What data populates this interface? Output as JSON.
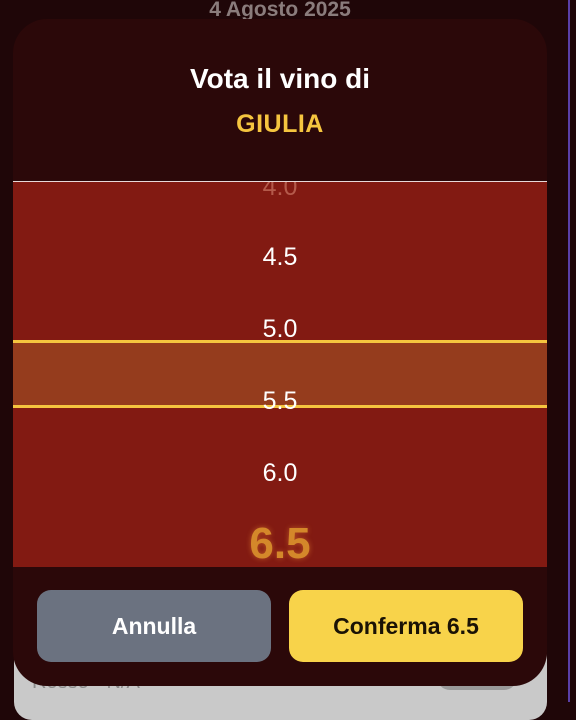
{
  "background": {
    "date": "4 Agosto 2025",
    "card_text": "Rosso - N/A"
  },
  "modal": {
    "title": "Vota il vino di",
    "subtitle": "GIULIA",
    "picker": {
      "options": [
        "4.0",
        "4.5",
        "5.0",
        "5.5",
        "6.0",
        "6.5"
      ],
      "selected": "6.5"
    },
    "cancel_label": "Annulla",
    "confirm_label": "Conferma 6.5"
  },
  "colors": {
    "accent": "#f5c53f",
    "picker_bg": "#821a12",
    "modal_bg": "#2b0809",
    "cancel_bg": "#6b7280",
    "confirm_bg": "#f8d34a"
  }
}
